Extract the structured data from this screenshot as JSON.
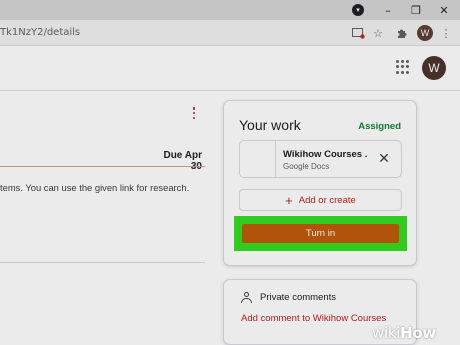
{
  "browser": {
    "url_fragment": "Tk1NzY2/details",
    "profile_initial": "W",
    "window_controls": {
      "minimize": "–",
      "restore": "❐",
      "close": "✕"
    }
  },
  "header": {
    "apps_icon": "grid-icon",
    "avatar_initial": "W"
  },
  "assignment": {
    "due": "Due Apr 30",
    "description": "tems. You can use the given link for research."
  },
  "your_work": {
    "title": "Your work",
    "status": "Assigned",
    "attachment": {
      "title": "Wikihow Courses ...",
      "type": "Google Docs"
    },
    "add_create_label": "Add or create",
    "turn_in_label": "Turn in"
  },
  "private_comments": {
    "title": "Private comments",
    "link": "Add comment to Wikihow Courses"
  },
  "watermark": {
    "wiki": "wiki",
    "how": "How"
  },
  "colors": {
    "turn_in_bg": "#c05c0a",
    "highlight": "#33dd22",
    "accent_red": "#c5221f",
    "assigned_green": "#188038"
  }
}
